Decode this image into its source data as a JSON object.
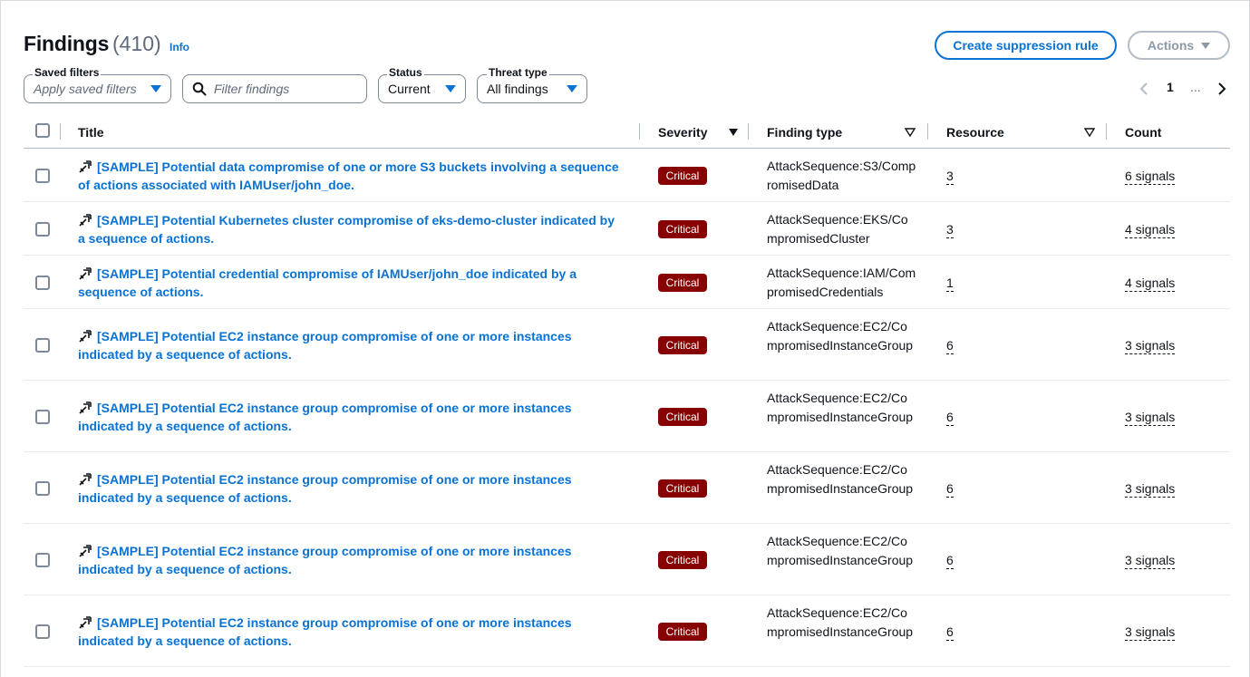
{
  "header": {
    "title": "Findings",
    "count": "(410)",
    "info": "Info",
    "create_button": "Create suppression rule",
    "actions_button": "Actions"
  },
  "filters": {
    "saved_filters_label": "Saved filters",
    "saved_filters_placeholder": "Apply saved filters",
    "search_placeholder": "Filter findings",
    "status_label": "Status",
    "status_value": "Current",
    "threat_type_label": "Threat type",
    "threat_type_value": "All findings"
  },
  "pagination": {
    "current_page": "1",
    "ellipsis": "..."
  },
  "table": {
    "columns": {
      "title": "Title",
      "severity": "Severity",
      "finding_type": "Finding type",
      "resource": "Resource",
      "count": "Count"
    },
    "rows": [
      {
        "title": "[SAMPLE] Potential data compromise of one or more S3 buckets involving a sequence of actions associated with IAMUser/john_doe.",
        "severity": "Critical",
        "finding_type": "AttackSequence:S3/CompromisedData",
        "resource": "3",
        "count": "6 signals"
      },
      {
        "title": "[SAMPLE] Potential Kubernetes cluster compromise of eks-demo-cluster indicated by a sequence of actions.",
        "severity": "Critical",
        "finding_type": "AttackSequence:EKS/CompromisedCluster",
        "resource": "3",
        "count": "4 signals"
      },
      {
        "title": "[SAMPLE] Potential credential compromise of IAMUser/john_doe indicated by a sequence of actions.",
        "severity": "Critical",
        "finding_type": "AttackSequence:IAM/CompromisedCredentials",
        "resource": "1",
        "count": "4 signals"
      },
      {
        "title": "[SAMPLE] Potential EC2 instance group compromise of one or more instances indicated by a sequence of actions.",
        "severity": "Critical",
        "finding_type": "AttackSequence:EC2/CompromisedInstanceGroup",
        "resource": "6",
        "count": "3 signals"
      },
      {
        "title": "[SAMPLE] Potential EC2 instance group compromise of one or more instances indicated by a sequence of actions.",
        "severity": "Critical",
        "finding_type": "AttackSequence:EC2/CompromisedInstanceGroup",
        "resource": "6",
        "count": "3 signals"
      },
      {
        "title": "[SAMPLE] Potential EC2 instance group compromise of one or more instances indicated by a sequence of actions.",
        "severity": "Critical",
        "finding_type": "AttackSequence:EC2/CompromisedInstanceGroup",
        "resource": "6",
        "count": "3 signals"
      },
      {
        "title": "[SAMPLE] Potential EC2 instance group compromise of one or more instances indicated by a sequence of actions.",
        "severity": "Critical",
        "finding_type": "AttackSequence:EC2/CompromisedInstanceGroup",
        "resource": "6",
        "count": "3 signals"
      },
      {
        "title": "[SAMPLE] Potential EC2 instance group compromise of one or more instances indicated by a sequence of actions.",
        "severity": "Critical",
        "finding_type": "AttackSequence:EC2/CompromisedInstanceGroup",
        "resource": "6",
        "count": "3 signals"
      }
    ]
  },
  "colors": {
    "link": "#0972d3",
    "critical": "#870303",
    "disabled": "#8d99a8"
  }
}
